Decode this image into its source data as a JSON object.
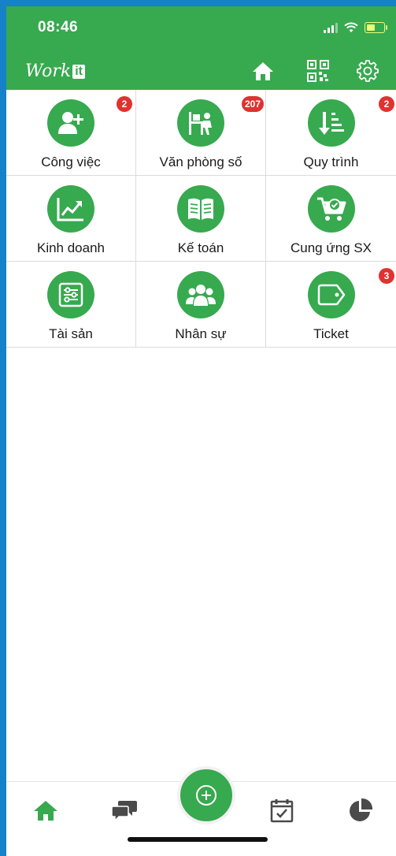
{
  "status_bar": {
    "time": "08:46"
  },
  "header": {
    "logo_text": "Work",
    "logo_badge": "it",
    "icons": [
      "home-icon",
      "qr-code-icon",
      "settings-gear-icon"
    ]
  },
  "modules": [
    {
      "label": "Công việc",
      "badge": "2",
      "icon": "add-user-icon"
    },
    {
      "label": "Văn phòng số",
      "badge": "207",
      "icon": "office-desk-icon"
    },
    {
      "label": "Quy trình",
      "badge": "2",
      "icon": "process-list-icon"
    },
    {
      "label": "Kinh doanh",
      "badge": "",
      "icon": "trending-chart-icon"
    },
    {
      "label": "Kế toán",
      "badge": "",
      "icon": "open-book-icon"
    },
    {
      "label": "Cung ứng SX",
      "badge": "",
      "icon": "shopping-cart-check-icon"
    },
    {
      "label": "Tài sản",
      "badge": "",
      "icon": "sliders-icon"
    },
    {
      "label": "Nhân sự",
      "badge": "",
      "icon": "people-group-icon"
    },
    {
      "label": "Ticket",
      "badge": "3",
      "icon": "tag-icon"
    }
  ],
  "bottom_nav": [
    "home-icon",
    "chat-icon",
    "add-icon",
    "calendar-check-icon",
    "pie-chart-icon"
  ],
  "colors": {
    "brand_green": "#37a94f",
    "badge_red": "#e0322f",
    "frame_blue": "#1481c9"
  }
}
